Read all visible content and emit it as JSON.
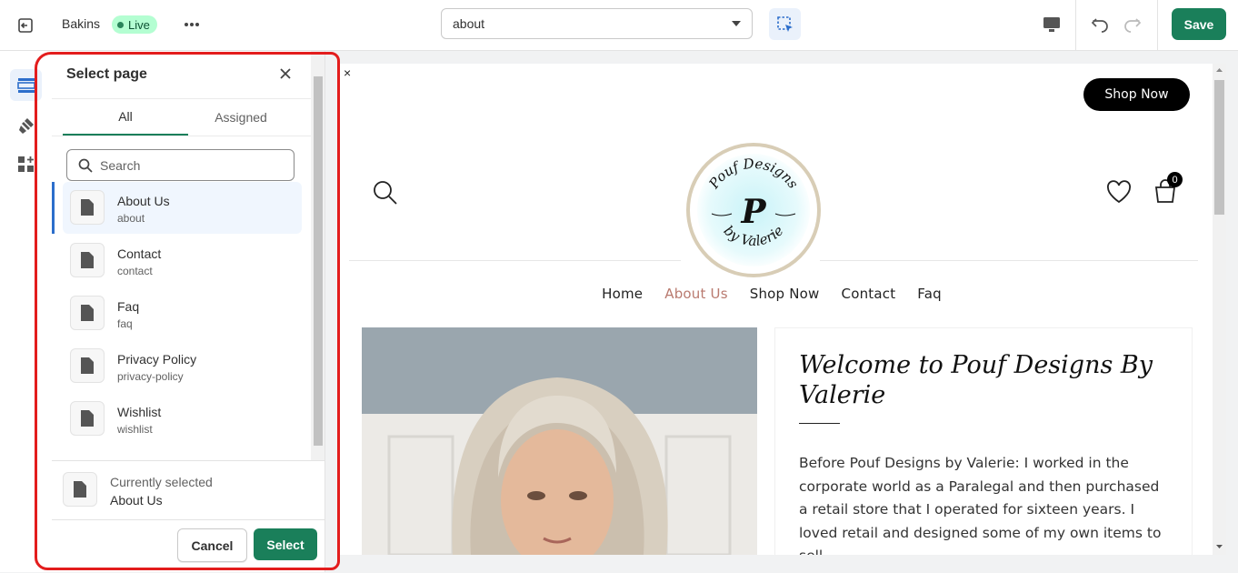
{
  "topbar": {
    "store_name": "Bakins",
    "status_badge": "Live",
    "page_selector_value": "about",
    "save_label": "Save"
  },
  "leftnav": {
    "items": [
      {
        "icon": "sections-icon",
        "active": true
      },
      {
        "icon": "theme-settings-icon",
        "active": false
      },
      {
        "icon": "app-embeds-icon",
        "active": false
      }
    ]
  },
  "panel": {
    "title": "Select page",
    "tabs": [
      {
        "label": "All",
        "active": true
      },
      {
        "label": "Assigned",
        "active": false
      }
    ],
    "search_placeholder": "Search",
    "pages": [
      {
        "title": "About Us",
        "handle": "about",
        "selected": true
      },
      {
        "title": "Contact",
        "handle": "contact",
        "selected": false
      },
      {
        "title": "Faq",
        "handle": "faq",
        "selected": false
      },
      {
        "title": "Privacy Policy",
        "handle": "privacy-policy",
        "selected": false
      },
      {
        "title": "Wishlist",
        "handle": "wishlist",
        "selected": false
      }
    ],
    "current_label": "Currently selected",
    "current_value": "About Us",
    "cancel_label": "Cancel",
    "select_label": "Select"
  },
  "preview": {
    "close_glyph": "×",
    "shop_now_button": "Shop Now",
    "cart_count": "0",
    "logo_top_text": "Pouf Designs",
    "logo_letter": "P",
    "logo_bottom_text": "by Valerie",
    "menu": [
      {
        "label": "Home",
        "current": false
      },
      {
        "label": "About Us",
        "current": true
      },
      {
        "label": "Shop Now",
        "current": false
      },
      {
        "label": "Contact",
        "current": false
      },
      {
        "label": "Faq",
        "current": false
      }
    ],
    "heading": "Welcome to Pouf Designs By Valerie",
    "body": "Before Pouf Designs by Valerie: I worked in the corporate world as a Paralegal and then purchased a retail store that I operated for sixteen years. I loved retail and designed some of my own items to sell."
  },
  "colors": {
    "accent_green": "#1a7f5a",
    "live_badge_bg": "#b4fed2",
    "highlight_red": "#e31d1d",
    "menu_current": "#b97a6f"
  }
}
